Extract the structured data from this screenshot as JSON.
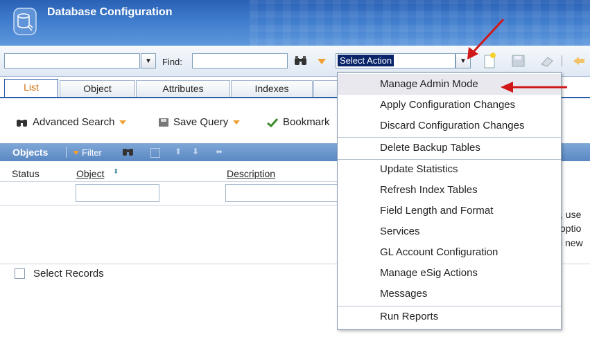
{
  "app": {
    "title": "Database Configuration"
  },
  "toolbar": {
    "find_label": "Find:",
    "find_value": "",
    "action_select_value": "Select Action"
  },
  "tabs": [
    "List",
    "Object",
    "Attributes",
    "Indexes"
  ],
  "query_bar": {
    "advanced_search": "Advanced Search",
    "save_query": "Save Query",
    "bookmarks": "Bookmark"
  },
  "objects_bar": {
    "title": "Objects",
    "filter": "Filter"
  },
  "columns": {
    "status": "Status",
    "object": "Object",
    "description": "Description"
  },
  "select_records": "Select Records",
  "side_fragments": [
    ", use",
    "optio",
    "i new"
  ],
  "menu": {
    "items": [
      "Manage Admin Mode",
      "Apply Configuration Changes",
      "Discard Configuration Changes",
      "Delete Backup Tables",
      "Update Statistics",
      "Refresh Index Tables",
      "Field Length and Format",
      "Services",
      "GL Account Configuration",
      "Manage eSig Actions",
      "Messages",
      "Run Reports"
    ]
  },
  "colors": {
    "header": "#3f7ccc",
    "tab_active": "#d07010",
    "arrow": "#d01818",
    "objects_bar": "#6a96cc"
  }
}
